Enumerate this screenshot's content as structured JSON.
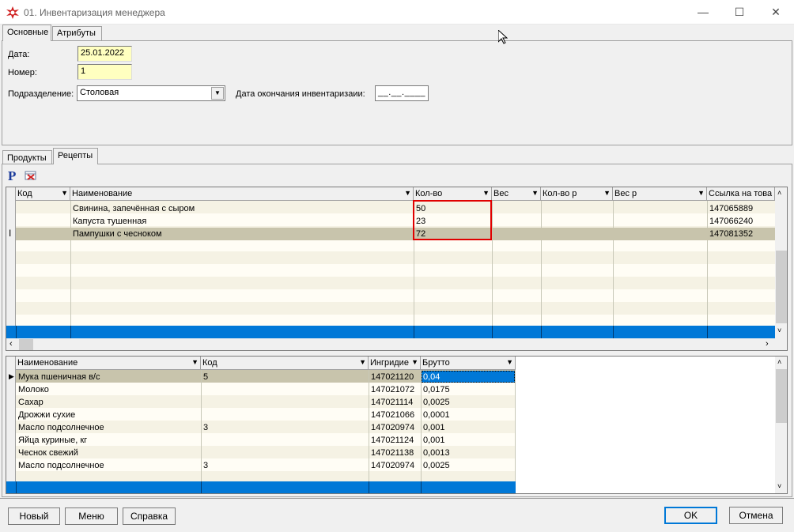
{
  "window": {
    "title": "01. Инвентаризация менеджера"
  },
  "top_tabs": [
    {
      "label": "Основные"
    },
    {
      "label": "Атрибуты"
    }
  ],
  "form": {
    "date_label": "Дата:",
    "date_value": "25.01.2022",
    "number_label": "Номер:",
    "number_value": "1",
    "division_label": "Подразделение:",
    "division_value": "Столовая",
    "end_date_label": "Дата окончания инвентаризаии:",
    "end_date_value": "__.__.____"
  },
  "sub_tabs": [
    {
      "label": "Продукты"
    },
    {
      "label": "Рецепты"
    }
  ],
  "toolbar": {
    "p_icon": "P"
  },
  "recipes_grid": {
    "columns": [
      "Код",
      "Наименование",
      "Кол-во",
      "Вес",
      "Кол-во р",
      "Вес р",
      "Ссылка на това"
    ],
    "rows": [
      {
        "code": "",
        "name": "Свинина, запечённая с сыром",
        "qty": "50",
        "weight": "",
        "qty_r": "",
        "weight_r": "",
        "link": "147065889"
      },
      {
        "code": "",
        "name": "Капуста тушенная",
        "qty": "23",
        "weight": "",
        "qty_r": "",
        "weight_r": "",
        "link": "147066240"
      },
      {
        "code": "",
        "name": "Пампушки с чесноком",
        "qty": "72",
        "weight": "",
        "qty_r": "",
        "weight_r": "",
        "link": "147081352"
      }
    ]
  },
  "ingredients_grid": {
    "columns": [
      "Наименование",
      "Код",
      "Ингридие",
      "Брутто"
    ],
    "rows": [
      {
        "name": "Мука пшеничная в/с",
        "code": "5",
        "ingr": "147021120",
        "brutto": "0,04"
      },
      {
        "name": "Молоко",
        "code": "",
        "ingr": "147021072",
        "brutto": "0,0175"
      },
      {
        "name": "Сахар",
        "code": "",
        "ingr": "147021114",
        "brutto": "0,0025"
      },
      {
        "name": "Дрожжи сухие",
        "code": "",
        "ingr": "147021066",
        "brutto": "0,0001"
      },
      {
        "name": "Масло подсолнечное",
        "code": "3",
        "ingr": "147020974",
        "brutto": "0,001"
      },
      {
        "name": "Яйца куриные, кг",
        "code": "",
        "ingr": "147021124",
        "brutto": "0,001"
      },
      {
        "name": "Чеснок свежий",
        "code": "",
        "ingr": "147021138",
        "brutto": "0,0013"
      },
      {
        "name": "Масло подсолнечное",
        "code": "3",
        "ingr": "147020974",
        "brutto": "0,0025"
      }
    ]
  },
  "buttons": {
    "new": "Новый",
    "menu": "Меню",
    "help": "Справка",
    "ok": "OK",
    "cancel": "Отмена"
  },
  "colors": {
    "selection_blue": "#0078d7",
    "field_yellow": "#ffffc0",
    "row_stripe": "#f5f2e4",
    "row_selected": "#c8c4ac",
    "highlight_border": "#e00000"
  }
}
